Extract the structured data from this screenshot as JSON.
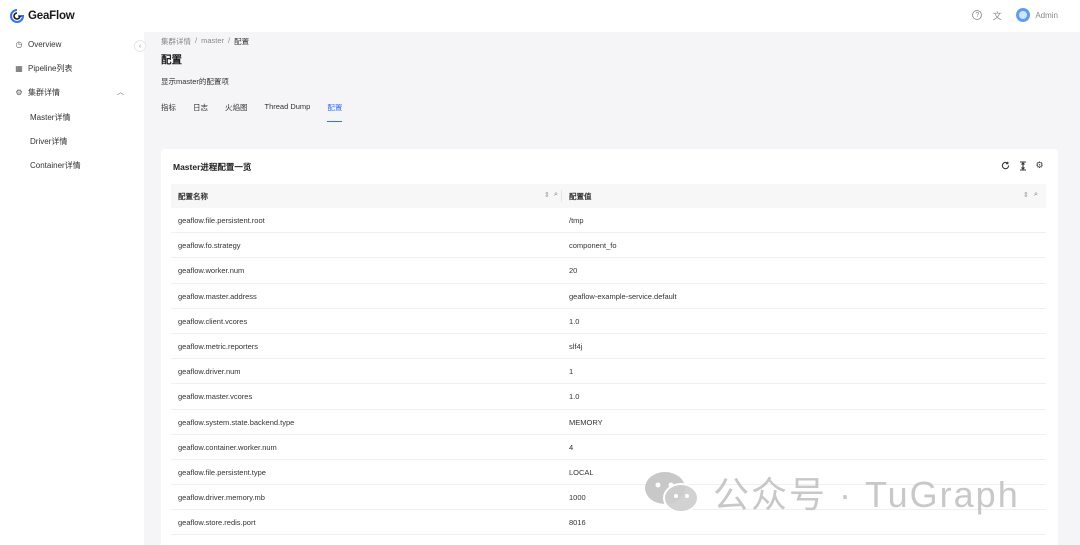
{
  "app": {
    "name": "GeaFlow",
    "user": "Admin",
    "help_icon": "help-icon",
    "lang_icon": "translate-icon"
  },
  "sidebar": {
    "items": [
      {
        "label": "Overview",
        "icon": "clock-icon"
      },
      {
        "label": "Pipeline列表",
        "icon": "table-icon"
      },
      {
        "label": "集群详情",
        "icon": "cluster-icon"
      }
    ],
    "subitems": [
      {
        "label": "Master详情"
      },
      {
        "label": "Driver详情"
      },
      {
        "label": "Container详情"
      }
    ]
  },
  "breadcrumb": {
    "items": [
      "集群详情",
      "master",
      "配置"
    ]
  },
  "page": {
    "title": "配置",
    "description": "显示master的配置项"
  },
  "tabs": [
    {
      "label": "指标"
    },
    {
      "label": "日志"
    },
    {
      "label": "火焰图"
    },
    {
      "label": "Thread Dump"
    },
    {
      "label": "配置",
      "active": true
    }
  ],
  "card": {
    "title": "Master进程配置一览",
    "tools": [
      "refresh-icon",
      "column-height-icon",
      "settings-icon"
    ],
    "columns": [
      "配置名称",
      "配置值"
    ],
    "rows": [
      [
        "geaflow.file.persistent.root",
        "/tmp"
      ],
      [
        "geaflow.fo.strategy",
        "component_fo"
      ],
      [
        "geaflow.worker.num",
        "20"
      ],
      [
        "geaflow.master.address",
        "geaflow-example-service.default"
      ],
      [
        "geaflow.client.vcores",
        "1.0"
      ],
      [
        "geaflow.metric.reporters",
        "slf4j"
      ],
      [
        "geaflow.driver.num",
        "1"
      ],
      [
        "geaflow.master.vcores",
        "1.0"
      ],
      [
        "geaflow.system.state.backend.type",
        "MEMORY"
      ],
      [
        "geaflow.container.worker.num",
        "4"
      ],
      [
        "geaflow.file.persistent.type",
        "LOCAL"
      ],
      [
        "geaflow.driver.memory.mb",
        "1000"
      ],
      [
        "geaflow.store.redis.port",
        "8016"
      ]
    ]
  },
  "watermark": {
    "text": "公众号 · TuGraph"
  },
  "colors": {
    "accent": "#3370ff",
    "background": "#f5f5f7"
  }
}
